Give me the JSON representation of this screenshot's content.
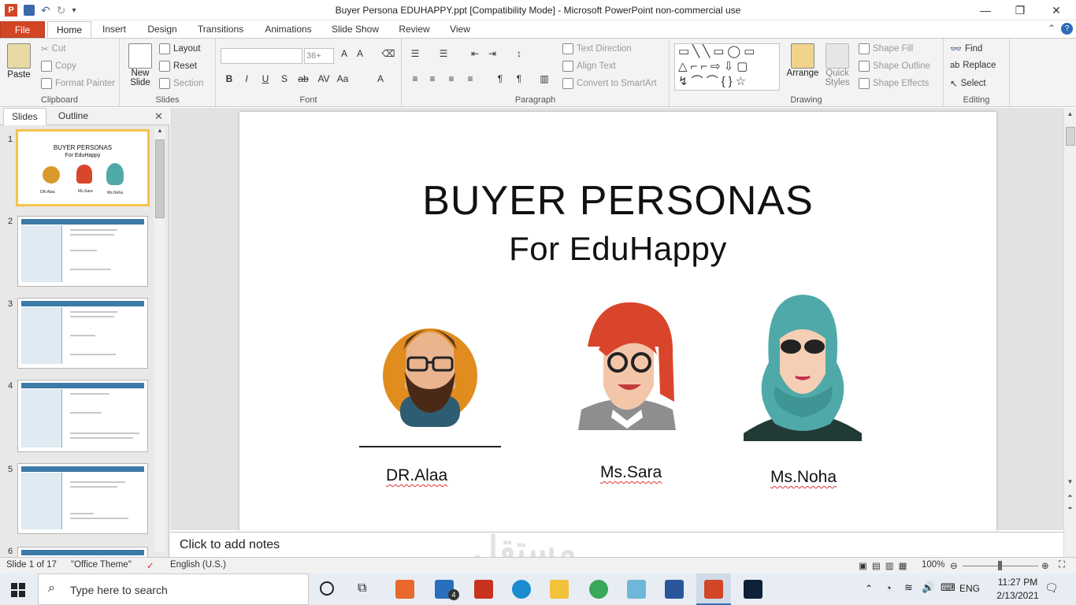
{
  "window": {
    "title": "Buyer Persona EDUHAPPY.ppt [Compatibility Mode]  -  Microsoft PowerPoint non-commercial use",
    "controls": [
      "minimize",
      "restore",
      "close"
    ]
  },
  "tabs": [
    "File",
    "Home",
    "Insert",
    "Design",
    "Transitions",
    "Animations",
    "Slide Show",
    "Review",
    "View"
  ],
  "ribbon": {
    "clipboard": {
      "paste": "Paste",
      "cut": "Cut",
      "copy": "Copy",
      "format_painter": "Format Painter",
      "label": "Clipboard"
    },
    "slides": {
      "new_slide": "New Slide",
      "layout": "Layout",
      "reset": "Reset",
      "section": "Section",
      "label": "Slides"
    },
    "font": {
      "size": "36+",
      "label": "Font"
    },
    "paragraph": {
      "text_direction": "Text Direction",
      "align_text": "Align Text",
      "convert": "Convert to SmartArt",
      "label": "Paragraph"
    },
    "drawing": {
      "arrange": "Arrange",
      "quick_styles": "Quick Styles",
      "shape_fill": "Shape Fill",
      "shape_outline": "Shape Outline",
      "shape_effects": "Shape Effects",
      "label": "Drawing"
    },
    "editing": {
      "find": "Find",
      "replace": "Replace",
      "select": "Select",
      "label": "Editing"
    }
  },
  "left_pane": {
    "tabs": [
      "Slides",
      "Outline"
    ],
    "thumbs": [
      {
        "num": "1",
        "title": "BUYER PERSONAS",
        "subtitle": "For EduHappy",
        "names": [
          "DR.Alaa",
          "Ms.Sara",
          "Ms.Noha"
        ]
      },
      {
        "num": "2"
      },
      {
        "num": "3"
      },
      {
        "num": "4"
      },
      {
        "num": "5"
      },
      {
        "num": "6"
      }
    ]
  },
  "slide": {
    "title": "BUYER PERSONAS",
    "subtitle": "For EduHappy",
    "personas": [
      {
        "name": "DR.Alaa"
      },
      {
        "name": "Ms.Sara"
      },
      {
        "name": "Ms.Noha"
      }
    ]
  },
  "notes": {
    "placeholder": "Click to add notes"
  },
  "status": {
    "slide_info": "Slide 1 of 17",
    "theme": "\"Office Theme\"",
    "language": "English (U.S.)",
    "zoom": "100%"
  },
  "taskbar": {
    "search_placeholder": "Type here to search",
    "time": "11:27 PM",
    "date": "2/13/2021",
    "lang": "ENG",
    "mail_badge": "4"
  },
  "watermark": "مستقل",
  "colors": {
    "file_tab": "#d24625",
    "selection": "#f3c44c",
    "accent": "#3c7aa7"
  }
}
